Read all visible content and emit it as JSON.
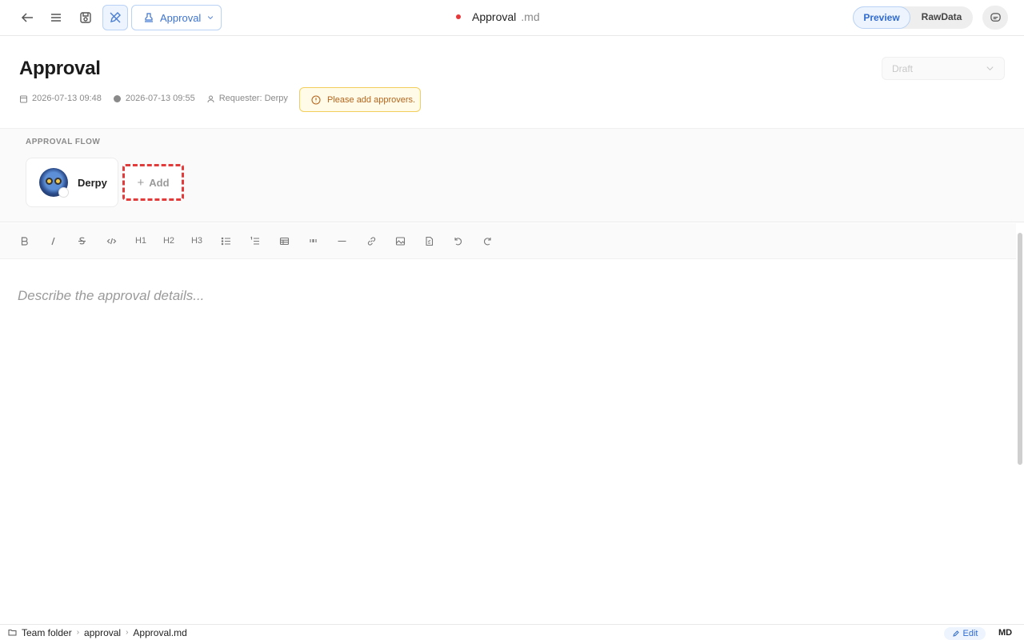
{
  "toolbar": {
    "type_dropdown_label": "Approval",
    "doc_name": "Approval",
    "doc_ext": ".md",
    "view_modes": [
      "Preview",
      "RawData"
    ],
    "active_view": "Preview"
  },
  "header": {
    "title": "Approval",
    "created": "2026-07-13 09:48",
    "updated": "2026-07-13 09:55",
    "requester": "Requester: Derpy",
    "warning": "Please add approvers.",
    "status": "Draft"
  },
  "flow": {
    "label": "APPROVAL FLOW",
    "approvers": [
      {
        "name": "Derpy"
      }
    ],
    "add_label": "Add"
  },
  "editor": {
    "tools": [
      "bold-icon",
      "italic-icon",
      "strikethrough-icon",
      "code-icon",
      "h1",
      "h2",
      "h3",
      "bullet-list-icon",
      "ordered-list-icon",
      "table-icon",
      "quote-icon",
      "hr-icon",
      "link-icon",
      "image-icon",
      "file-icon",
      "undo-icon",
      "redo-icon"
    ],
    "h1_label": "H1",
    "h2_label": "H2",
    "h3_label": "H3",
    "placeholder": "Describe the approval details..."
  },
  "statusbar": {
    "breadcrumbs": [
      "Team folder",
      "approval",
      "Approval.md"
    ],
    "edit_label": "Edit",
    "mode": "MD"
  },
  "colors": {
    "accent": "#2f6bd0",
    "warning_border": "#f2cf5c",
    "highlight": "#e23b3b",
    "unsaved_dot": "#e5383b"
  }
}
